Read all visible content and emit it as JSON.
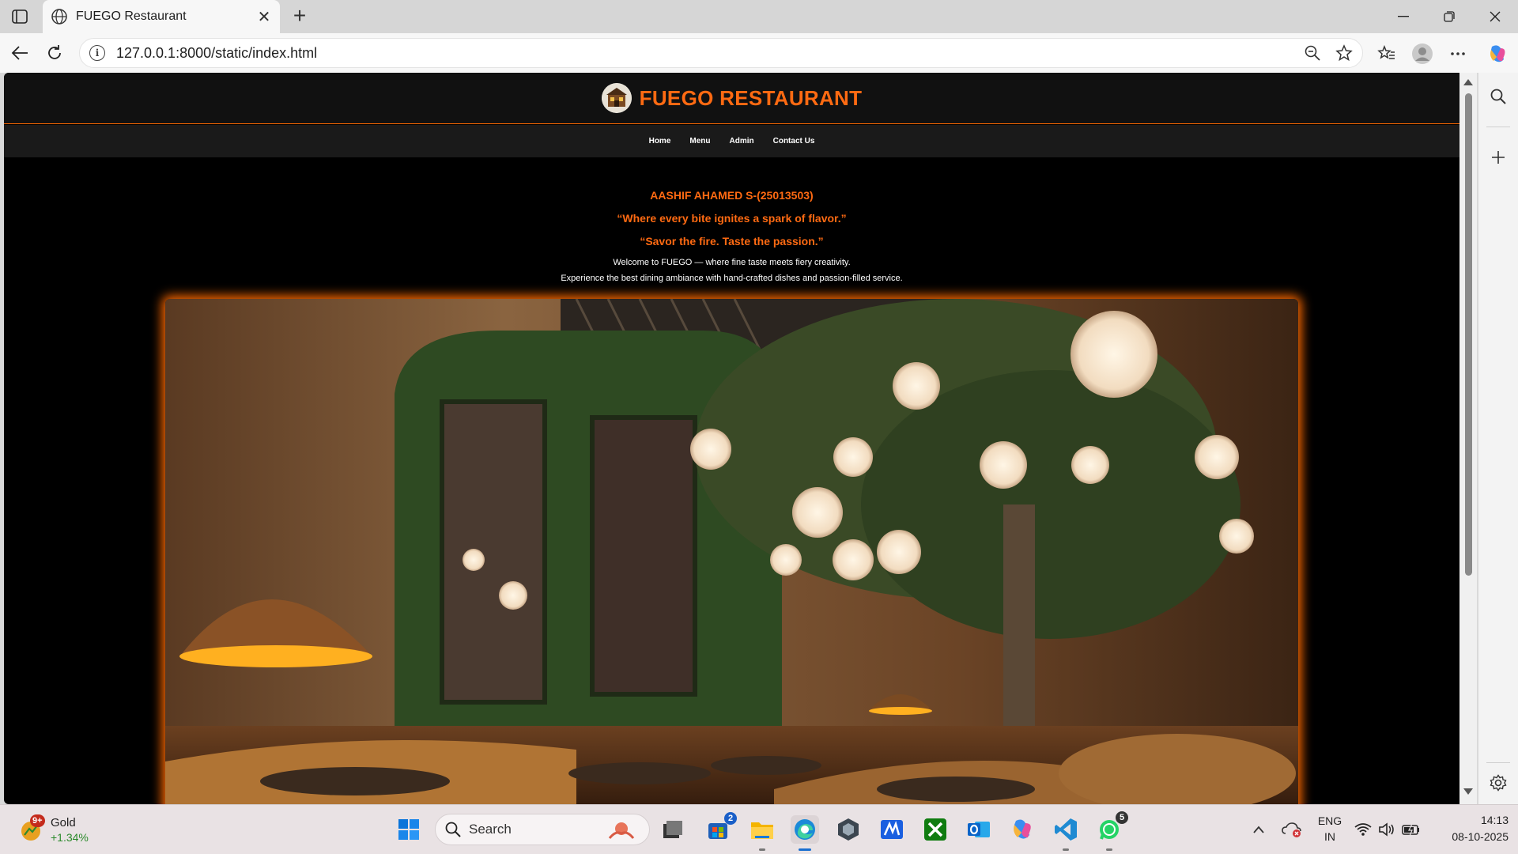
{
  "browser": {
    "tab_title": "FUEGO Restaurant",
    "url": "127.0.0.1:8000/static/index.html"
  },
  "site": {
    "brand": "FUEGO RESTAURANT",
    "nav": [
      "Home",
      "Menu",
      "Admin",
      "Contact Us"
    ],
    "hero": {
      "name": "AASHIF AHAMED S-(25013503)",
      "quote1": "“Where every bite ignites a spark of flavor.”",
      "quote2": "“Savor the fire. Taste the passion.”",
      "welcome1": "Welcome to FUEGO — where fine taste meets fiery creativity.",
      "welcome2": "Experience the best dining ambiance with hand-crafted dishes and passion-filled service."
    },
    "accent_color": "#ff6a12"
  },
  "taskbar": {
    "widget": {
      "badge": "9+",
      "name": "Gold",
      "change": "+1.34%"
    },
    "search_label": "Search",
    "store_badge": "2",
    "whatsapp_badge": "5",
    "lang": "ENG",
    "region": "IN",
    "time": "14:13",
    "date": "08-10-2025"
  }
}
